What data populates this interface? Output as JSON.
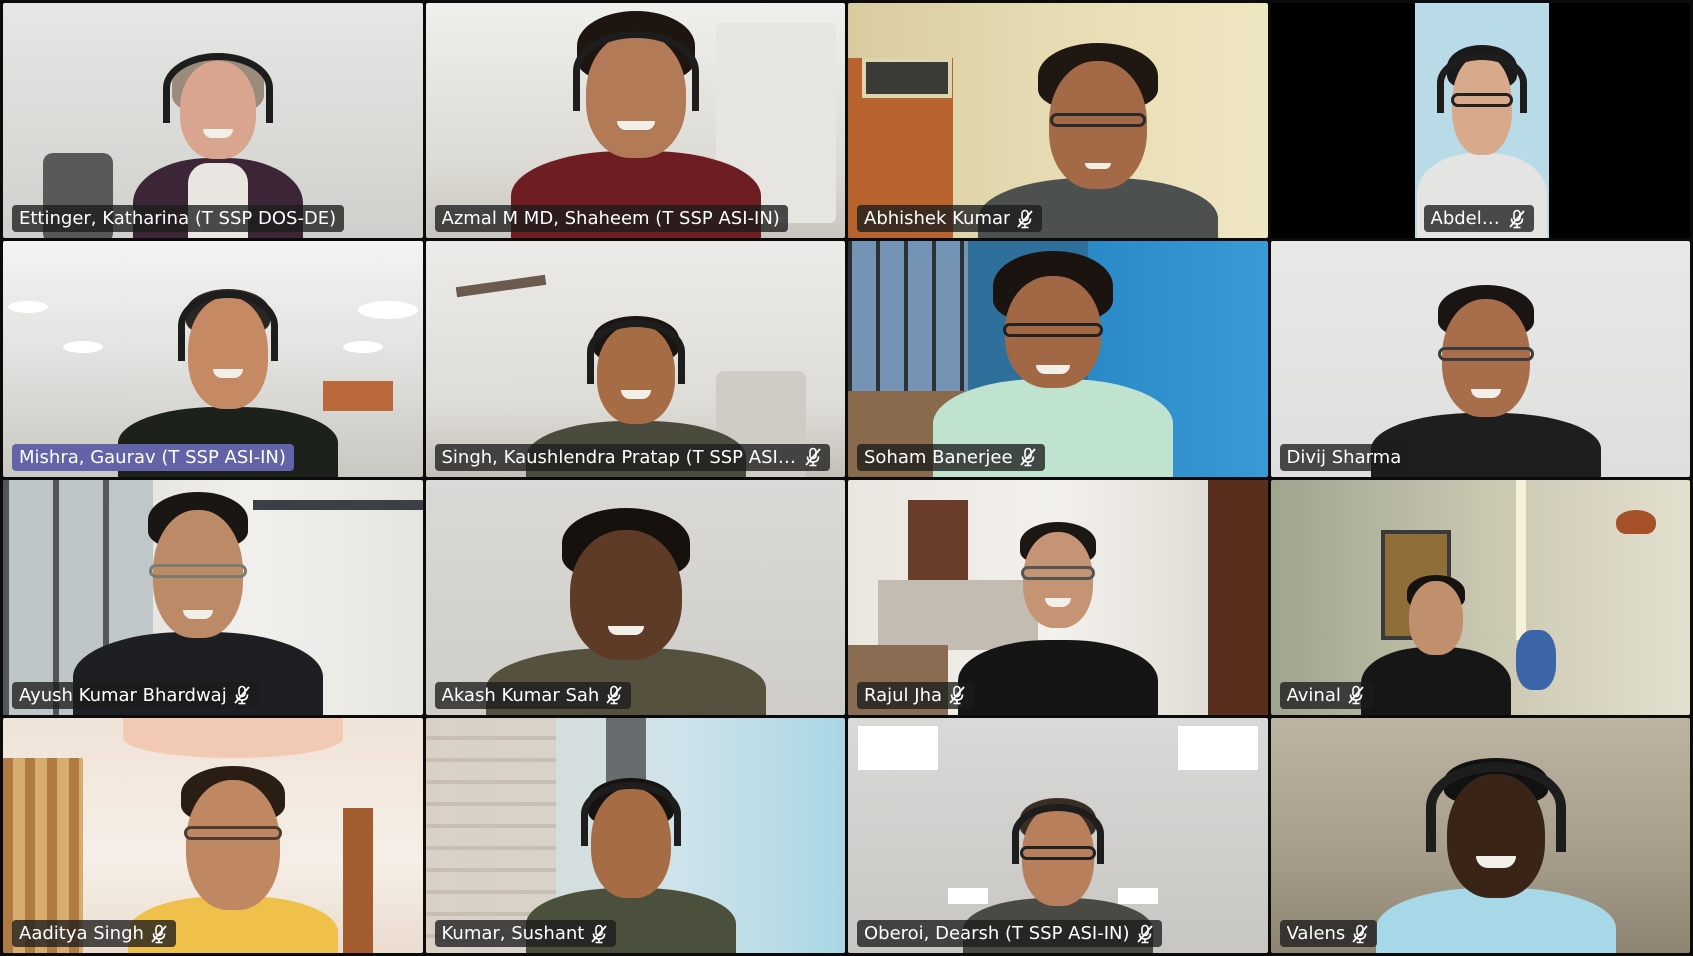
{
  "participants": [
    {
      "name": "Ettinger, Katharina (T SSP DOS-DE)",
      "muted": false,
      "active_speaker": false
    },
    {
      "name": "Azmal M MD, Shaheem (T SSP ASI-IN)",
      "muted": false,
      "active_speaker": false
    },
    {
      "name": "Abhishek Kumar",
      "muted": true,
      "active_speaker": false
    },
    {
      "name": "Abdelr...",
      "muted": true,
      "active_speaker": false
    },
    {
      "name": "Mishra, Gaurav (T SSP ASI-IN)",
      "muted": false,
      "active_speaker": true
    },
    {
      "name": "Singh, Kaushlendra Pratap (T SSP ASI-I...",
      "muted": true,
      "active_speaker": false
    },
    {
      "name": "Soham Banerjee",
      "muted": true,
      "active_speaker": false
    },
    {
      "name": "Divij Sharma",
      "muted": false,
      "active_speaker": false
    },
    {
      "name": "Ayush Kumar Bhardwaj",
      "muted": true,
      "active_speaker": false
    },
    {
      "name": "Akash Kumar Sah",
      "muted": true,
      "active_speaker": false
    },
    {
      "name": "Rajul Jha",
      "muted": true,
      "active_speaker": false
    },
    {
      "name": "Avinal",
      "muted": true,
      "active_speaker": false
    },
    {
      "name": "Aaditya Singh",
      "muted": true,
      "active_speaker": false
    },
    {
      "name": "Kumar, Sushant",
      "muted": true,
      "active_speaker": false
    },
    {
      "name": "Oberoi, Dearsh (T SSP ASI-IN)",
      "muted": true,
      "active_speaker": false
    },
    {
      "name": "Valens",
      "muted": true,
      "active_speaker": false
    }
  ],
  "colors": {
    "name_tag_bg": "#1c1c1c",
    "active_speaker_bg": "#6264a7",
    "name_text": "#ffffff",
    "window_bg": "#0b0b0b"
  },
  "icons": {
    "muted": "mic-off-icon"
  }
}
